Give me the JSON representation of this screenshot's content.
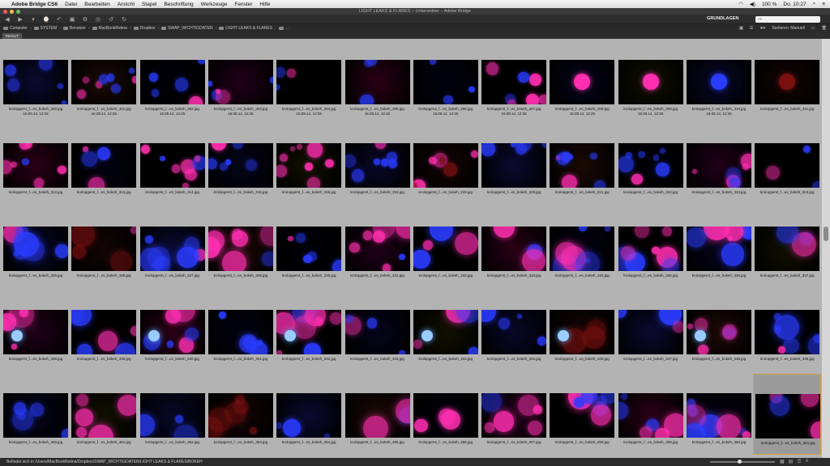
{
  "menubar": {
    "app_name": "Adobe Bridge CS6",
    "items": [
      "Datei",
      "Bearbeiten",
      "Ansicht",
      "Stapel",
      "Beschriftung",
      "Werkzeuge",
      "Fenster",
      "Hilfe"
    ],
    "battery": "100 %",
    "clock": "Do. 10:27"
  },
  "window": {
    "title": "LIGHT LEAKS & FLARES – Unterordner – Adobe Bridge"
  },
  "toolbar": {
    "workspace_label": "GRUNDLAGEN",
    "search_placeholder": "⌕▾"
  },
  "pathbar": {
    "crumbs": [
      "Computer",
      "SYSTEM",
      "Benutzer",
      "MacBookRetina",
      "Dropbox",
      "SWAP_WICHTIGDATEN",
      "LIGHT LEAKS & FLARES",
      "..."
    ],
    "sort_label": "Sortieren: Manuell"
  },
  "panel": {
    "tab_label": "INHALT"
  },
  "status": {
    "text": "Befindet sich in /Users/MacBookRetina/Dropbox/SWAP_WICHTIGDATEN/LIGHT LEAKS & FLARES/BOKEH"
  },
  "zoom_level": 0.45,
  "colors": {
    "pink": "#ff2fb0",
    "blue": "#2a3cff",
    "selection": "#d2a04a"
  },
  "items": [
    {
      "name": "krolopgerst_f...es_bokeh_300.jpg",
      "date": "16.09.14, 12:25"
    },
    {
      "name": "krolopgerst_f...es_bokeh_301.jpg",
      "date": "16.09.14, 12:25"
    },
    {
      "name": "krolopgerst_f...es_bokeh_302.jpg",
      "date": "16.09.14, 12:25"
    },
    {
      "name": "krolopgerst_f...es_bokeh_303.jpg",
      "date": "16.09.14, 12:25"
    },
    {
      "name": "krolopgerst_f...es_bokeh_304.jpg",
      "date": "16.09.14, 12:25"
    },
    {
      "name": "krolopgerst_f...es_bokeh_305.jpg",
      "date": "16.09.14, 12:25"
    },
    {
      "name": "krolopgerst_f...es_bokeh_306.jpg",
      "date": "16.09.14, 12:25"
    },
    {
      "name": "krolopgerst_f...es_bokeh_307.jpg",
      "date": "16.09.14, 12:25"
    },
    {
      "name": "krolopgerst_f...es_bokeh_308.jpg",
      "date": "16.09.14, 12:25"
    },
    {
      "name": "krolopgerst_f...es_bokeh_309.jpg",
      "date": "16.09.14, 12:25"
    },
    {
      "name": "krolopgerst_f...es_bokeh_310.jpg",
      "date": "16.09.14, 12:26"
    },
    {
      "name": "krolopgerst_f...es_bokeh_311.jpg",
      "date": ""
    },
    {
      "name": "krolopgerst_f...es_bokeh_312.jpg",
      "date": ""
    },
    {
      "name": "krolopgerst_f...es_bokeh_313.jpg",
      "date": ""
    },
    {
      "name": "krolopgerst_f...es_bokeh_314.jpg",
      "date": ""
    },
    {
      "name": "krolopgerst_f...es_bokeh_315.jpg",
      "date": ""
    },
    {
      "name": "krolopgerst_f...es_bokeh_316.jpg",
      "date": ""
    },
    {
      "name": "krolopgerst_f...es_bokeh_318.jpg",
      "date": ""
    },
    {
      "name": "krolopgerst_f...es_bokeh_319.jpg",
      "date": ""
    },
    {
      "name": "krolopgerst_f...es_bokeh_320.jpg",
      "date": ""
    },
    {
      "name": "krolopgerst_f...es_bokeh_321.jpg",
      "date": ""
    },
    {
      "name": "krolopgerst_f...es_bokeh_322.jpg",
      "date": ""
    },
    {
      "name": "krolopgerst_f...es_bokeh_323.jpg",
      "date": ""
    },
    {
      "name": "krolopgerst_f...es_bokeh_324.jpg",
      "date": ""
    },
    {
      "name": "krolopgerst_f...es_bokeh_325.jpg",
      "date": ""
    },
    {
      "name": "krolopgerst_f...es_bokeh_326.jpg",
      "date": ""
    },
    {
      "name": "krolopgerst_f...es_bokeh_327.jpg",
      "date": ""
    },
    {
      "name": "krolopgerst_f...es_bokeh_328.jpg",
      "date": ""
    },
    {
      "name": "krolopgerst_f...es_bokeh_330.jpg",
      "date": ""
    },
    {
      "name": "krolopgerst_f...es_bokeh_331.jpg",
      "date": ""
    },
    {
      "name": "krolopgerst_f...es_bokeh_332.jpg",
      "date": ""
    },
    {
      "name": "krolopgerst_f...es_bokeh_333.jpg",
      "date": ""
    },
    {
      "name": "krolopgerst_f...es_bokeh_334.jpg",
      "date": ""
    },
    {
      "name": "krolopgerst_f...es_bokeh_335.jpg",
      "date": ""
    },
    {
      "name": "krolopgerst_f...es_bokeh_336.jpg",
      "date": ""
    },
    {
      "name": "krolopgerst_f...es_bokeh_337.jpg",
      "date": ""
    },
    {
      "name": "krolopgerst_f...es_bokeh_338.jpg",
      "date": ""
    },
    {
      "name": "krolopgerst_f...es_bokeh_339.jpg",
      "date": ""
    },
    {
      "name": "krolopgerst_f...es_bokeh_340.jpg",
      "date": ""
    },
    {
      "name": "krolopgerst_f...es_bokeh_341.jpg",
      "date": ""
    },
    {
      "name": "krolopgerst_f...es_bokeh_342.jpg",
      "date": ""
    },
    {
      "name": "krolopgerst_f...es_bokeh_343.jpg",
      "date": ""
    },
    {
      "name": "krolopgerst_f...es_bokeh_344.jpg",
      "date": ""
    },
    {
      "name": "krolopgerst_f...es_bokeh_345.jpg",
      "date": ""
    },
    {
      "name": "krolopgerst_f...es_bokeh_346.jpg",
      "date": ""
    },
    {
      "name": "krolopgerst_f...es_bokeh_347.jpg",
      "date": ""
    },
    {
      "name": "krolopgerst_f...es_bokeh_348.jpg",
      "date": ""
    },
    {
      "name": "krolopgerst_f...es_bokeh_349.jpg",
      "date": ""
    },
    {
      "name": "krolopgerst_f...es_bokeh_350.jpg",
      "date": ""
    },
    {
      "name": "krolopgerst_f...es_bokeh_351.jpg",
      "date": ""
    },
    {
      "name": "krolopgerst_f...es_bokeh_352.jpg",
      "date": ""
    },
    {
      "name": "krolopgerst_f...es_bokeh_353.jpg",
      "date": ""
    },
    {
      "name": "krolopgerst_f...es_bokeh_354.jpg",
      "date": ""
    },
    {
      "name": "krolopgerst_f...es_bokeh_355.jpg",
      "date": ""
    },
    {
      "name": "krolopgerst_f...es_bokeh_356.jpg",
      "date": ""
    },
    {
      "name": "krolopgerst_f...es_bokeh_357.jpg",
      "date": ""
    },
    {
      "name": "krolopgerst_f...es_bokeh_358.jpg",
      "date": ""
    },
    {
      "name": "krolopgerst_f...es_bokeh_359.jpg",
      "date": ""
    },
    {
      "name": "krolopgerst_f...es_bokeh_360.jpg",
      "date": ""
    },
    {
      "name": "krolopgerst_f...es_bokeh_361.jpg",
      "date": "",
      "selected": true
    }
  ]
}
